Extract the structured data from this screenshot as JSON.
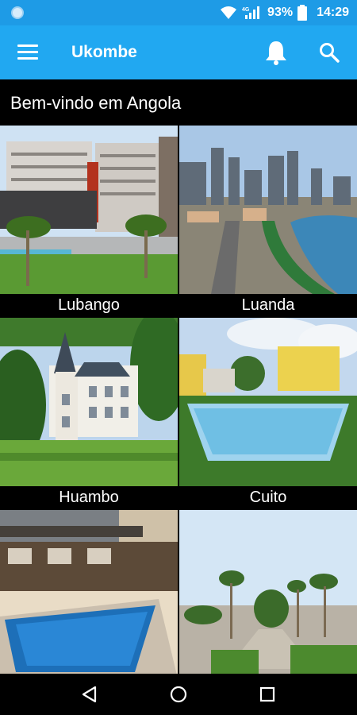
{
  "status": {
    "battery": "93%",
    "time": "14:29"
  },
  "app_bar": {
    "title": "Ukombe"
  },
  "heading": "Bem-vindo em Angola",
  "cities": [
    {
      "name": "Lubango"
    },
    {
      "name": "Luanda"
    },
    {
      "name": "Huambo"
    },
    {
      "name": "Cuito"
    },
    {
      "name": ""
    },
    {
      "name": ""
    }
  ],
  "colors": {
    "status_bar": "#1e9be6",
    "app_bar": "#21a8f1",
    "background": "#000000"
  }
}
